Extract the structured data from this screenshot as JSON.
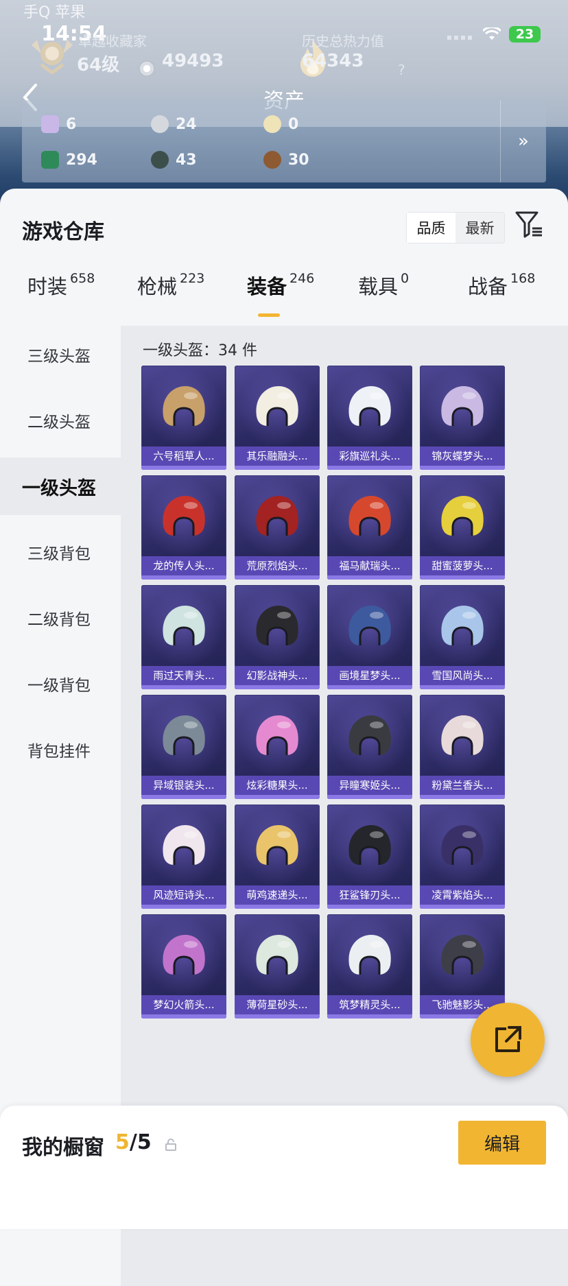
{
  "status_bar": {
    "carrier_label": "手Q 苹果",
    "time": "14:54",
    "battery": "23"
  },
  "profile": {
    "title_label": "卓越收藏家",
    "level": "64级",
    "coins": "49493",
    "heat_label": "历史总热力值",
    "heat_value": "64343",
    "help_icon": "?"
  },
  "nav": {
    "title": "资产",
    "back_icon": "chevron-left-icon"
  },
  "assets": {
    "items": [
      {
        "icon": "crystal-icon",
        "value": "6",
        "color": "#c9b7e8"
      },
      {
        "icon": "silver-coin-icon",
        "value": "24",
        "color": "#d5d9de"
      },
      {
        "icon": "gold-coin-icon",
        "value": "0",
        "color": "#efe3b8"
      },
      {
        "icon": "green-card-icon",
        "value": "294",
        "color": "#2f8a5a"
      },
      {
        "icon": "dark-medal-icon",
        "value": "43",
        "color": "#3d4f4a"
      },
      {
        "icon": "bronze-medal-icon",
        "value": "30",
        "color": "#8d5a32"
      }
    ],
    "more_label": "»"
  },
  "warehouse": {
    "title": "游戏仓库",
    "sort_options": [
      "品质",
      "最新"
    ],
    "sort_selected": "品质",
    "filter_icon": "filter-icon"
  },
  "tabs": [
    {
      "label": "时装",
      "count": "658"
    },
    {
      "label": "枪械",
      "count": "223"
    },
    {
      "label": "装备",
      "count": "246",
      "active": true
    },
    {
      "label": "载具",
      "count": "0"
    },
    {
      "label": "战备",
      "count": "168"
    }
  ],
  "sidebar": [
    {
      "label": "三级头盔"
    },
    {
      "label": "二级头盔"
    },
    {
      "label": "一级头盔",
      "active": true
    },
    {
      "label": "三级背包"
    },
    {
      "label": "二级背包"
    },
    {
      "label": "一级背包"
    },
    {
      "label": "背包挂件"
    }
  ],
  "section": {
    "count_label": "一级头盔：34 件"
  },
  "items": [
    {
      "name": "六号稻草人...",
      "color": "#c8a06a"
    },
    {
      "name": "其乐融融头...",
      "color": "#f2eee2"
    },
    {
      "name": "彩旗巡礼头...",
      "color": "#eef1f6"
    },
    {
      "name": "锦灰蝶梦头...",
      "color": "#c9b9e3"
    },
    {
      "name": "龙的传人头...",
      "color": "#c9322b"
    },
    {
      "name": "荒原烈焰头...",
      "color": "#a32222"
    },
    {
      "name": "福马献瑞头...",
      "color": "#d6482e"
    },
    {
      "name": "甜蜜菠萝头...",
      "color": "#e6cf3c"
    },
    {
      "name": "雨过天青头...",
      "color": "#cfe3e0"
    },
    {
      "name": "幻影战神头...",
      "color": "#2a2a2e"
    },
    {
      "name": "画境星梦头...",
      "color": "#3e5a9e"
    },
    {
      "name": "雪国风尚头...",
      "color": "#a9c6ea"
    },
    {
      "name": "异域银装头...",
      "color": "#7c8a98"
    },
    {
      "name": "炫彩糖果头...",
      "color": "#e58ad0"
    },
    {
      "name": "异瞳寒姬头...",
      "color": "#3a3b40"
    },
    {
      "name": "粉黛兰香头...",
      "color": "#e8dada"
    },
    {
      "name": "风迹短诗头...",
      "color": "#f0e6ee"
    },
    {
      "name": "萌鸡速递头...",
      "color": "#e9c46b"
    },
    {
      "name": "狂鲨锋刃头...",
      "color": "#24262b"
    },
    {
      "name": "凌霄紫焰头...",
      "color": "#3a3068"
    },
    {
      "name": "梦幻火箭头...",
      "color": "#c274cc"
    },
    {
      "name": "薄荷星砂头...",
      "color": "#dde8de"
    },
    {
      "name": "筑梦精灵头...",
      "color": "#eceff2"
    },
    {
      "name": "飞驰魅影头...",
      "color": "#3e3e48"
    }
  ],
  "fab": {
    "icon": "share-external-icon"
  },
  "showcase": {
    "title": "我的橱窗",
    "current": "5",
    "total": "/5",
    "edit_label": "编辑"
  },
  "colors": {
    "accent": "#f1b532",
    "item_bg": "#2c2a63",
    "name_bar": "#5e4cbe"
  }
}
